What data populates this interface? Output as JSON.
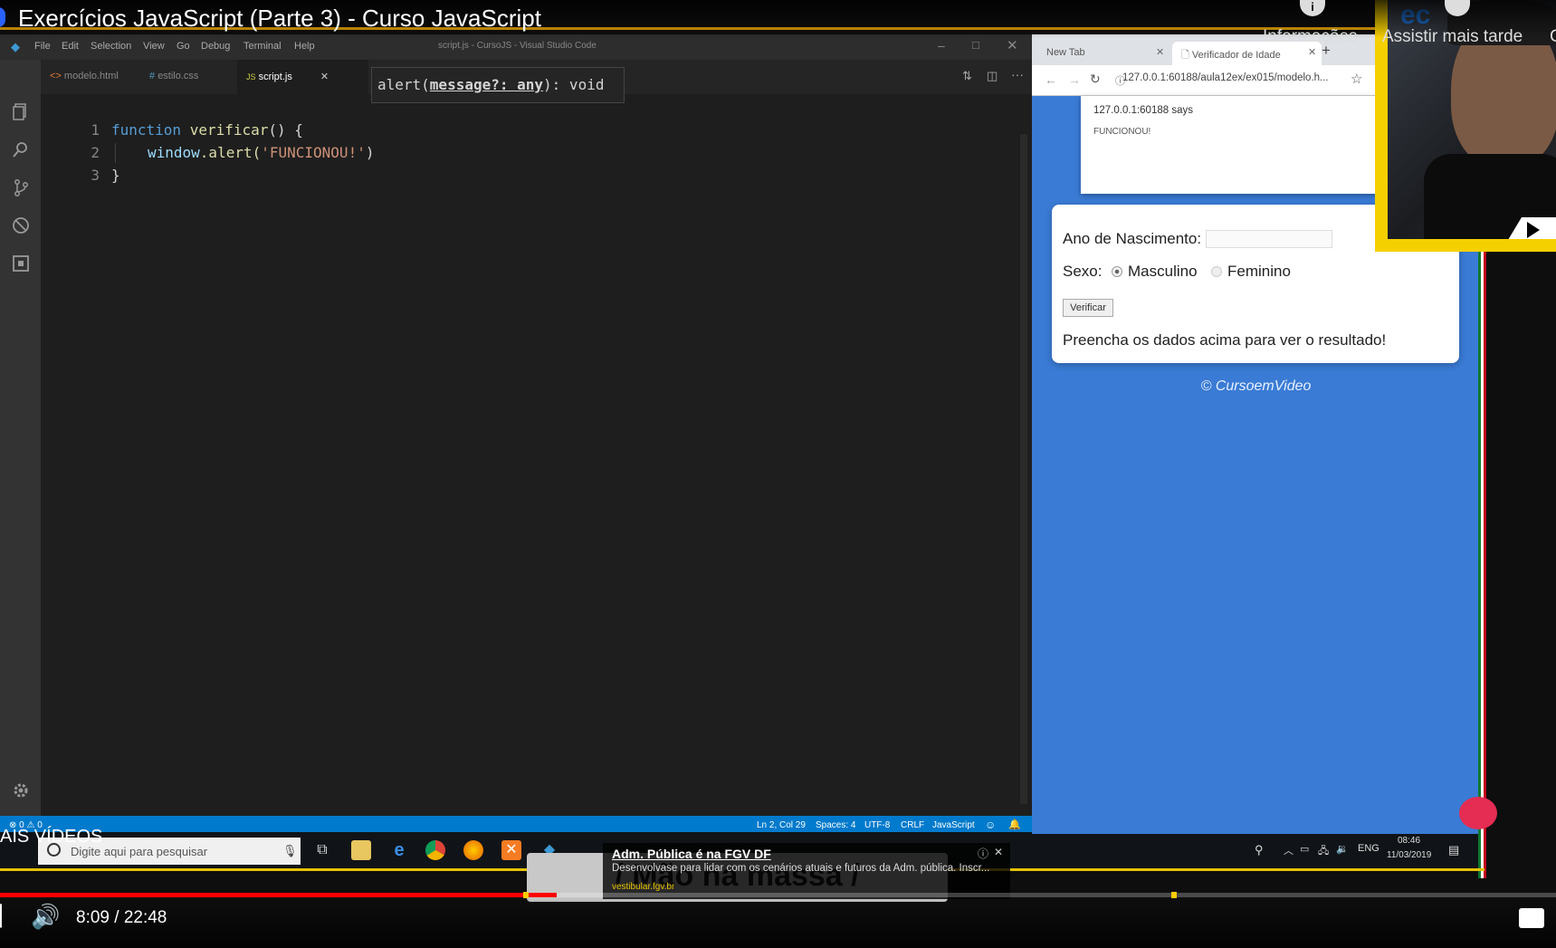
{
  "video": {
    "title": "Exercícios JavaScript (Parte 3) - Curso JavaScript",
    "btn_info": "Informações",
    "btn_watch_later": "Assistir mais tarde",
    "btn_cut": "C",
    "time": "8:09 / 22:48",
    "more_videos": "AIS VÍDEOS",
    "progress": 0.358
  },
  "vscode": {
    "window_title": "script.js - CursoJS - Visual Studio Code",
    "menu": [
      "File",
      "Edit",
      "Selection",
      "View",
      "Go",
      "Debug",
      "Terminal",
      "Help"
    ],
    "tabs": [
      {
        "label": "modelo.html",
        "icon": "<>"
      },
      {
        "label": "estilo.css",
        "icon": "#"
      },
      {
        "label": "script.js",
        "icon": "JS"
      }
    ],
    "hover_tip": {
      "prefix": "alert(",
      "param": "message?: any",
      "suffix": "): void"
    },
    "lines": [
      "1",
      "2",
      "3"
    ],
    "code": {
      "l1_kw": "function",
      "l1_fn": "verificar",
      "l1_rest": "() {",
      "l2_obj": "window",
      "l2_fn": ".alert(",
      "l2_str": "'FUNCIONOU!'",
      "l2_end": ")",
      "l3": "}"
    },
    "status": {
      "left": "⊗ 0 ⚠ 0",
      "position": "Ln 2, Col 29",
      "spaces": "Spaces: 4",
      "encoding": "UTF-8",
      "eol": "CRLF",
      "language": "JavaScript"
    }
  },
  "taskbar": {
    "search_placeholder": "Digite aqui para pesquisar",
    "lang": "ENG",
    "time": "08:46",
    "date": "11/03/2019"
  },
  "browser": {
    "tab1": "New Tab",
    "tab2": "Verificador de Idade",
    "url": "127.0.0.1:60188/aula12ex/ex015/modelo.h...",
    "alert_origin": "127.0.0.1:60188 says",
    "alert_message": "FUNCIONOU!",
    "label_year": "Ano de Nascimento:",
    "label_sex": "Sexo:",
    "option_m": "Masculino",
    "option_f": "Feminino",
    "button_verify": "Verificar",
    "result": "Preencha os dados acima para ver o resultado!",
    "footer": "© CursoemVideo"
  },
  "ad": {
    "title": "Adm. Pública é na FGV DF",
    "text": "Desenvolvase para lidar com os cenários atuais e futuros da Adm. pública. Inscr...",
    "url": "vestibular.fgv.br"
  },
  "overlay": {
    "banner": "/ Mão na massa /"
  }
}
